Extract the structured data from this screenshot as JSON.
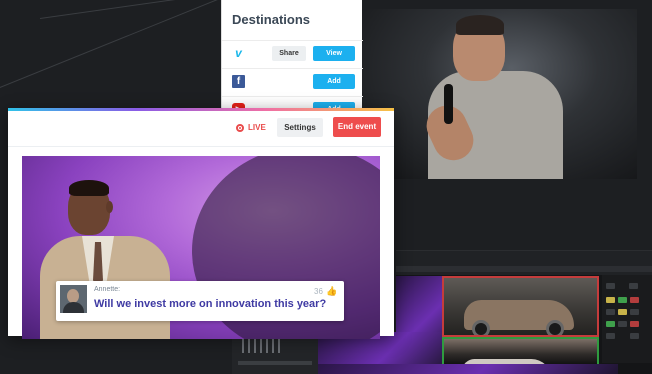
{
  "destinations": {
    "title": "Destinations",
    "items": [
      {
        "service": "Vimeo",
        "icon": "vimeo-icon",
        "glyph": "v",
        "buttons": [
          "Share",
          "View"
        ]
      },
      {
        "service": "Facebook",
        "icon": "facebook-icon",
        "glyph": "f",
        "buttons": [
          "Add"
        ]
      },
      {
        "service": "YouTube",
        "icon": "youtube-icon",
        "glyph": "▶",
        "buttons": [
          "Add"
        ]
      }
    ]
  },
  "live_event": {
    "status": "LIVE",
    "settings_label": "Settings",
    "end_label": "End event",
    "comment": {
      "author": "Annette:",
      "text": "Will we invest more on innovation this year?",
      "likes": "36"
    }
  },
  "colors": {
    "accent_blue": "#1cb0ef",
    "live_red": "#e94b4b",
    "end_button_red": "#ee4d4d",
    "comment_text": "#3f3aa3"
  }
}
